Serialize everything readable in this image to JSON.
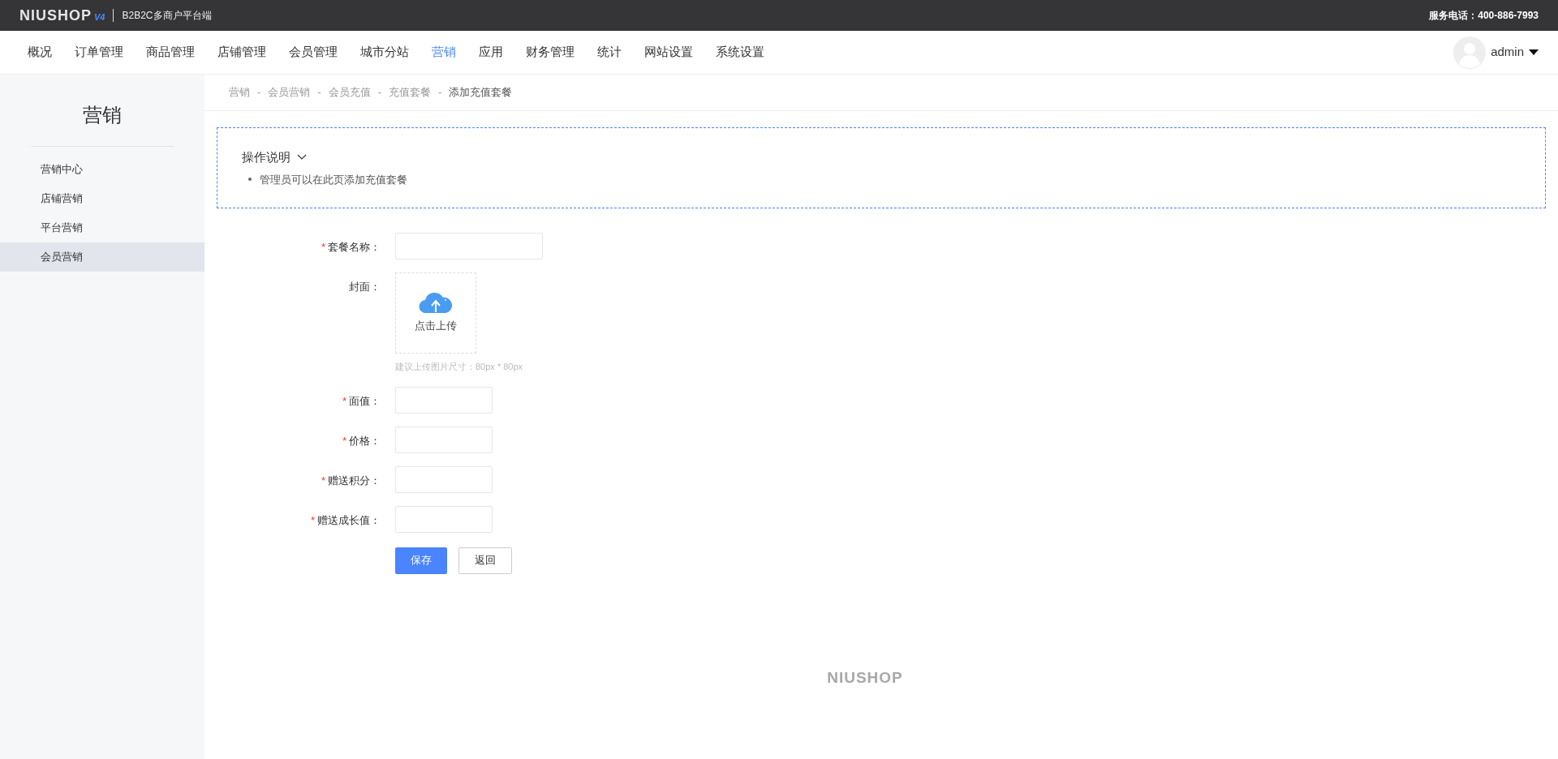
{
  "topbar": {
    "logo": "NIUSHOP",
    "version": "V4",
    "subtitle": "B2B2C多商户平台端",
    "hotline": "服务电话：400-886-7993"
  },
  "nav": [
    {
      "label": "概况",
      "selected": false
    },
    {
      "label": "订单管理",
      "selected": false
    },
    {
      "label": "商品管理",
      "selected": false
    },
    {
      "label": "店铺管理",
      "selected": false
    },
    {
      "label": "会员管理",
      "selected": false
    },
    {
      "label": "城市分站",
      "selected": false
    },
    {
      "label": "营销",
      "selected": true
    },
    {
      "label": "应用",
      "selected": false
    },
    {
      "label": "财务管理",
      "selected": false
    },
    {
      "label": "统计",
      "selected": false
    },
    {
      "label": "网站设置",
      "selected": false
    },
    {
      "label": "系统设置",
      "selected": false
    }
  ],
  "user": {
    "name": "admin"
  },
  "sidebar": {
    "title": "营销",
    "items": [
      {
        "label": "营销中心",
        "selected": false
      },
      {
        "label": "店铺营销",
        "selected": false
      },
      {
        "label": "平台营销",
        "selected": false
      },
      {
        "label": "会员营销",
        "selected": true
      }
    ]
  },
  "breadcrumb": [
    {
      "label": "营销"
    },
    {
      "separator": "-",
      "label": "会员营销"
    },
    {
      "separator": "-",
      "label": "会员充值"
    },
    {
      "separator": "-",
      "label": "充值套餐"
    },
    {
      "separator": "-",
      "label": "添加充值套餐"
    }
  ],
  "info": {
    "title": "操作说明",
    "expanded": true,
    "items": [
      "管理员可以在此页添加充值套餐"
    ]
  },
  "form": {
    "fields": [
      {
        "kind": "text",
        "required_mark": "*",
        "label": "套餐名称：",
        "wide": true
      },
      {
        "kind": "upload",
        "label": "封面：",
        "upload_text": "点击上传",
        "hint": "建议上传图片尺寸：80px * 80px"
      },
      {
        "kind": "text",
        "required_mark": "*",
        "label": "面值：",
        "wide": false
      },
      {
        "kind": "text",
        "required_mark": "*",
        "label": "价格：",
        "wide": false
      },
      {
        "kind": "text",
        "required_mark": "*",
        "label": "赠送积分：",
        "wide": false
      },
      {
        "kind": "text",
        "required_mark": "*",
        "label": "赠送成长值：",
        "wide": false
      }
    ],
    "save": "保存",
    "back": "返回"
  },
  "footer": {
    "logo": "NIUSHOP"
  }
}
